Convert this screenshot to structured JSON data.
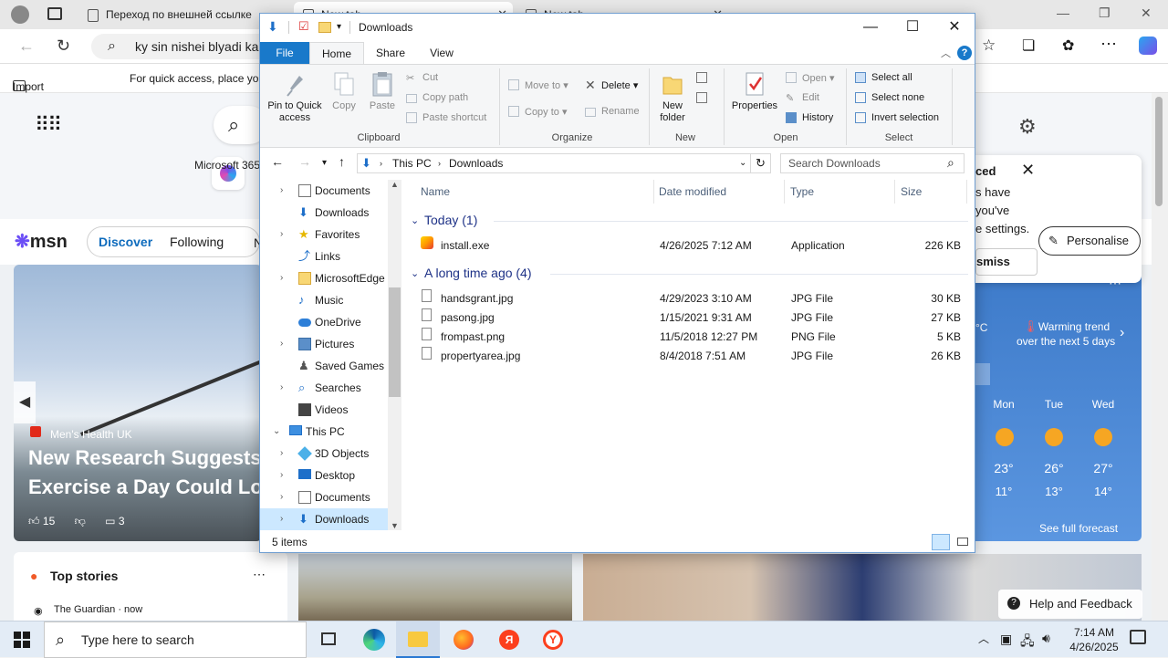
{
  "browser": {
    "tabs": [
      {
        "label": "Переход по внешней ссылке"
      },
      {
        "label": "New tab"
      },
      {
        "label": "New tab"
      }
    ],
    "address": "ky sin nishei blyadi kal",
    "favorites": {
      "import": "Import favorites",
      "hint": "For quick access, place your"
    }
  },
  "msn": {
    "logo": "msn",
    "app_tile": "Microsoft 365",
    "nav": {
      "discover": "Discover",
      "following": "Following",
      "more": "N"
    },
    "personalise": "Personalise",
    "hero": {
      "source": "Men's Health UK",
      "title": "New Research Suggests Exercise a Day Could Lo",
      "likes": "15",
      "comments": "3"
    },
    "popup": {
      "title": "ced",
      "body_lines": [
        "s have",
        " you've",
        "e settings."
      ],
      "dismiss": "smiss"
    },
    "weather": {
      "trend_line1": "Warming trend",
      "trend_line2": "over the next 5 days",
      "unit": "°C",
      "days": [
        {
          "name": "Mon",
          "hi": "23°",
          "lo": "11°"
        },
        {
          "name": "Tue",
          "hi": "26°",
          "lo": "13°"
        },
        {
          "name": "Wed",
          "hi": "27°",
          "lo": "14°"
        }
      ],
      "forecast_link": "See full forecast"
    },
    "top_stories": {
      "title": "Top stories",
      "source": "The Guardian · now"
    },
    "help": "Help and Feedback"
  },
  "explorer": {
    "title": "Downloads",
    "ribbon_tabs": {
      "file": "File",
      "home": "Home",
      "share": "Share",
      "view": "View"
    },
    "clipboard": {
      "pin": "Pin to Quick access",
      "copy": "Copy",
      "paste": "Paste",
      "cut": "Cut",
      "copy_path": "Copy path",
      "paste_shortcut": "Paste shortcut",
      "label": "Clipboard"
    },
    "organize": {
      "move_to": "Move to",
      "copy_to": "Copy to",
      "delete": "Delete",
      "rename": "Rename",
      "label": "Organize"
    },
    "new": {
      "new_folder": "New folder",
      "label": "New"
    },
    "open": {
      "properties": "Properties",
      "open": "Open",
      "edit": "Edit",
      "history": "History",
      "label": "Open"
    },
    "select": {
      "select_all": "Select all",
      "select_none": "Select none",
      "invert": "Invert selection",
      "label": "Select"
    },
    "path": {
      "root": "This PC",
      "folder": "Downloads"
    },
    "search_placeholder": "Search Downloads",
    "nav_items": [
      {
        "label": "Documents"
      },
      {
        "label": "Downloads"
      },
      {
        "label": "Favorites"
      },
      {
        "label": "Links"
      },
      {
        "label": "MicrosoftEdge"
      },
      {
        "label": "Music"
      },
      {
        "label": "OneDrive"
      },
      {
        "label": "Pictures"
      },
      {
        "label": "Saved Games"
      },
      {
        "label": "Searches"
      },
      {
        "label": "Videos"
      },
      {
        "label": "This PC"
      },
      {
        "label": "3D Objects"
      },
      {
        "label": "Desktop"
      },
      {
        "label": "Documents"
      },
      {
        "label": "Downloads"
      }
    ],
    "columns": {
      "name": "Name",
      "date": "Date modified",
      "type": "Type",
      "size": "Size"
    },
    "groups": [
      {
        "label": "Today (1)",
        "files": [
          {
            "name": "install.exe",
            "date": "4/26/2025 7:12 AM",
            "type": "Application",
            "size": "226 KB"
          }
        ]
      },
      {
        "label": "A long time ago (4)",
        "files": [
          {
            "name": "handsgrant.jpg",
            "date": "4/29/2023 3:10 AM",
            "type": "JPG File",
            "size": "30 KB"
          },
          {
            "name": "pasong.jpg",
            "date": "1/15/2021 9:31 AM",
            "type": "JPG File",
            "size": "27 KB"
          },
          {
            "name": "frompast.png",
            "date": "11/5/2018 12:27 PM",
            "type": "PNG File",
            "size": "5 KB"
          },
          {
            "name": "propertyarea.jpg",
            "date": "8/4/2018 7:51 AM",
            "type": "JPG File",
            "size": "26 KB"
          }
        ]
      }
    ],
    "status": "5 items"
  },
  "taskbar": {
    "search_placeholder": "Type here to search",
    "time": "7:14 AM",
    "date": "4/26/2025"
  }
}
